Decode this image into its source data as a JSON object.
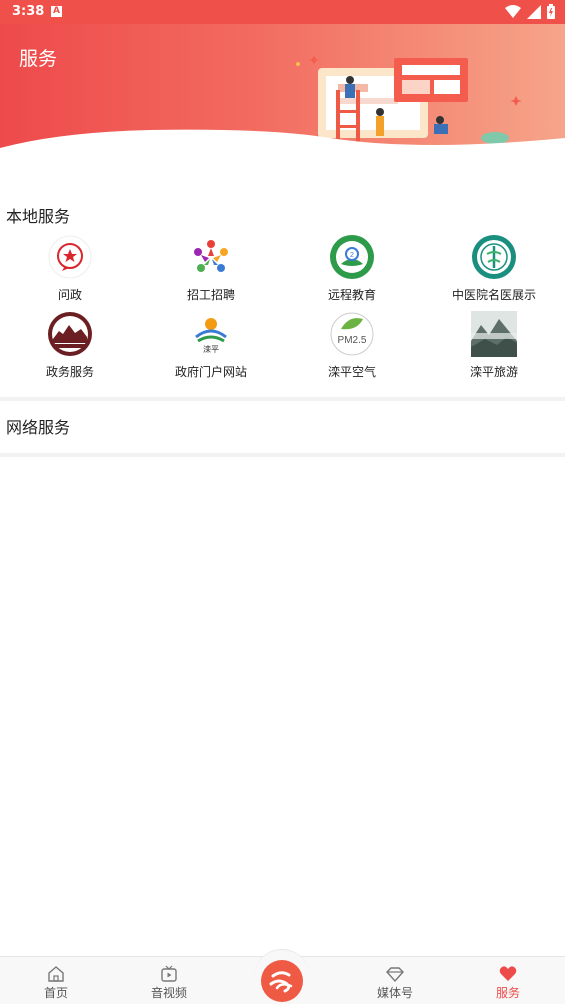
{
  "status_bar": {
    "time": "3:38",
    "notification_letter": "A"
  },
  "header": {
    "title": "服务"
  },
  "local_services": {
    "title": "本地服务",
    "items": [
      {
        "label": "问政",
        "icon": "red-star-icon"
      },
      {
        "label": "招工招聘",
        "icon": "people-pinwheel-icon"
      },
      {
        "label": "远程教育",
        "icon": "education-seal-icon"
      },
      {
        "label": "中医院名医展示",
        "icon": "hospital-seal-icon"
      },
      {
        "label": "政务服务",
        "icon": "great-wall-seal-icon"
      },
      {
        "label": "政府门户网站",
        "icon": "luanping-logo-icon"
      },
      {
        "label": "滦平空气",
        "icon": "pm25-leaf-icon",
        "icon_text": "PM2.5"
      },
      {
        "label": "滦平旅游",
        "icon": "mountain-landscape-icon"
      }
    ]
  },
  "network_services": {
    "title": "网络服务"
  },
  "bottom_nav": {
    "items": [
      {
        "label": "首页",
        "icon": "home-icon",
        "active": false
      },
      {
        "label": "音视频",
        "icon": "video-play-icon",
        "active": false
      },
      {
        "label": "",
        "icon": "center-logo-icon",
        "active": false
      },
      {
        "label": "媒体号",
        "icon": "diamond-icon",
        "active": false
      },
      {
        "label": "服务",
        "icon": "heart-icon",
        "active": true
      }
    ]
  },
  "colors": {
    "accent": "#ec4b4a",
    "banner_start": "#ee4a4b",
    "banner_end": "#f6a58a"
  }
}
